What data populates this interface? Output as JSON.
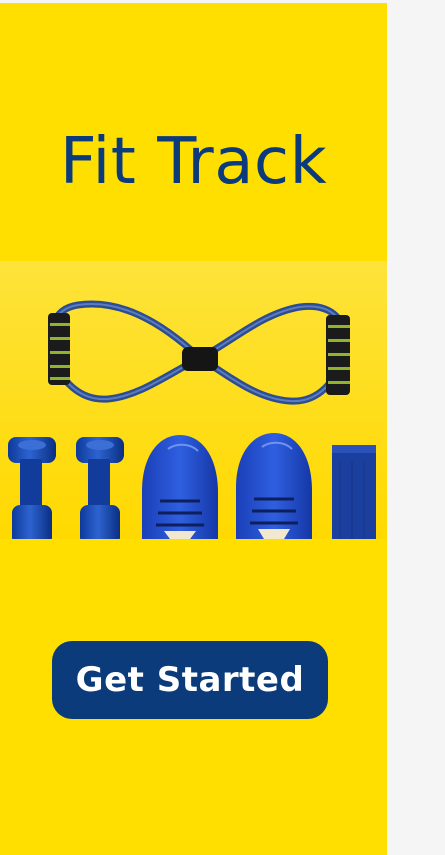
{
  "app": {
    "title": "Fit Track"
  },
  "hero": {
    "image_name": "fitness-equipment-photo",
    "items": [
      "resistance-band",
      "dumbbell",
      "dumbbell",
      "sneaker",
      "sneaker",
      "wristband"
    ]
  },
  "actions": {
    "get_started_label": "Get Started"
  },
  "colors": {
    "background": "#ffdf00",
    "primary": "#0b3b7a",
    "button_text": "#ffffff",
    "page_margin": "#f5f5f5"
  }
}
